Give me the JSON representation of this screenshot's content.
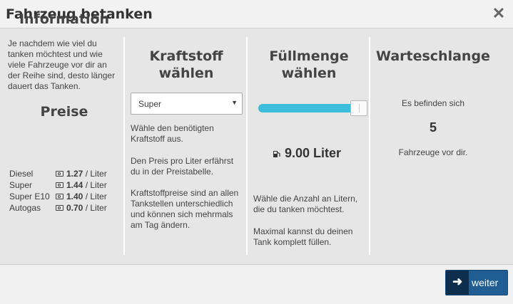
{
  "dialog": {
    "title": "Fahrzeug betanken",
    "close_icon": "close-icon"
  },
  "information": {
    "heading": "Information",
    "text": "Je nachdem wie viel du tanken möchtest und wie viele Fahrzeuge vor dir an der Reihe sind, desto länger dauert das Tanken.",
    "prices_heading": "Preise",
    "prices": [
      {
        "name": "Diesel",
        "price": "1.27",
        "unit": "/ Liter"
      },
      {
        "name": "Super",
        "price": "1.44",
        "unit": "/ Liter"
      },
      {
        "name": "Super E10",
        "price": "1.40",
        "unit": "/ Liter"
      },
      {
        "name": "Autogas",
        "price": "0.70",
        "unit": "/ Liter"
      }
    ]
  },
  "fuel": {
    "heading_line1": "Kraftstoff",
    "heading_line2": "wählen",
    "selected": "Super",
    "help1": "Wähle den benötigten Kraftstoff aus.",
    "help2": "Den Preis pro Liter erfährst du in der Preistabelle.",
    "help3": "Kraftstoffpreise sind an allen Tankstellen unterschiedlich und können sich mehrmals am Tag ändern."
  },
  "amount": {
    "heading_line1": "Füllmenge",
    "heading_line2": "wählen",
    "slider_fraction": 0.93,
    "value": "9.00 Liter",
    "icon": "fuel-pump-icon",
    "help1": "Wähle die Anzahl an Litern, die du tanken möchtest.",
    "help2": "Maximal kannst du deinen Tank komplett füllen."
  },
  "queue": {
    "heading": "Warteschlange",
    "line1": "Es befinden sich",
    "count": "5",
    "line2": "Fahrzeuge vor dir."
  },
  "footer": {
    "next_label": "weiter",
    "next_icon": "arrow-right-icon"
  },
  "colors": {
    "accent": "#3bbddb",
    "button": "#1f5d93",
    "button_icon_bg": "#0d2f4d"
  }
}
